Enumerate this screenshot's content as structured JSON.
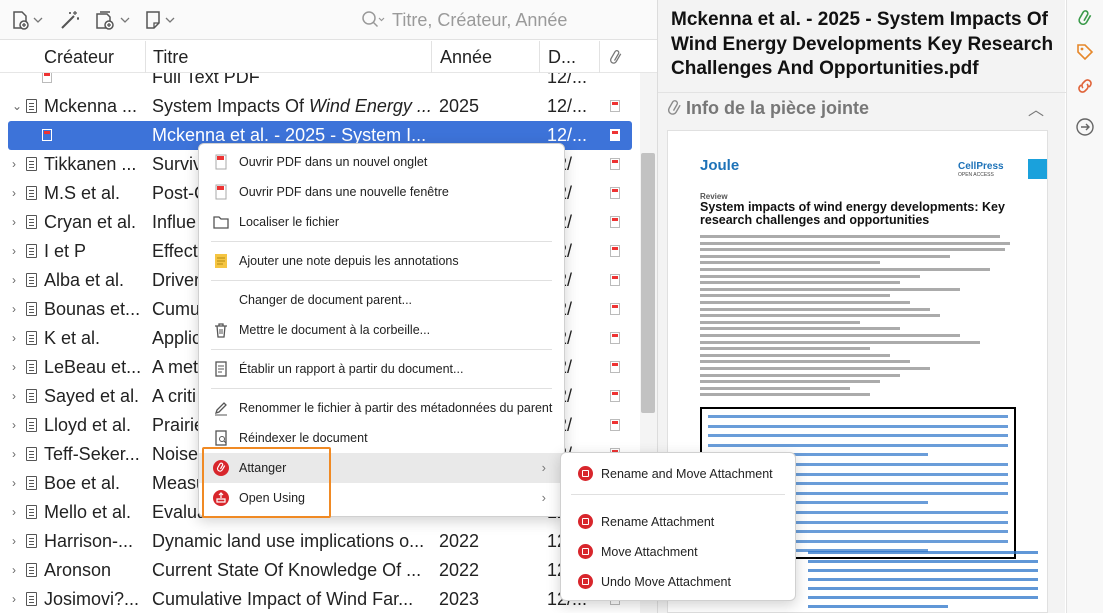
{
  "toolbar": {
    "new_item_icon": "new-item-icon",
    "wand_icon": "magic-wand-icon",
    "attach_icon": "add-attachment-icon",
    "note_icon": "new-note-icon",
    "search_placeholder": "Titre, Créateur, Année"
  },
  "columns": {
    "creator": "Créateur",
    "title": "Titre",
    "year": "Année",
    "date": "D..."
  },
  "rows": [
    {
      "creator": "",
      "title": "Full Text PDF",
      "year": "",
      "date": "12/...",
      "kind": "attachment-child"
    },
    {
      "creator": "Mckenna ...",
      "title_prefix": "System Impacts Of ",
      "title_italic": "Wind Energy ...",
      "year": "2025",
      "date": "12/...",
      "kind": "item-open"
    },
    {
      "creator": "",
      "title": "Mckenna et al. - 2025 - System I...",
      "year": "",
      "date": "12/...",
      "kind": "attachment-selected"
    },
    {
      "creator": "Tikkanen ...",
      "title": "Surviv",
      "year": "",
      "date": "12/",
      "kind": "item"
    },
    {
      "creator": "M.S et al.",
      "title": "Post-C",
      "year": "",
      "date": "12/",
      "kind": "item"
    },
    {
      "creator": "Cryan et al.",
      "title": "Influe",
      "year": "",
      "date": "12/",
      "kind": "item"
    },
    {
      "creator": "I et P",
      "title": "Effect",
      "year": "",
      "date": "12/",
      "kind": "item"
    },
    {
      "creator": "Alba et al.",
      "title": "Driver",
      "year": "",
      "date": "12/",
      "kind": "item"
    },
    {
      "creator": "Bounas et...",
      "title": "Cumu",
      "year": "",
      "date": "12/",
      "kind": "item"
    },
    {
      "creator": "K et al.",
      "title": "Applic",
      "year": "",
      "date": "12/",
      "kind": "item"
    },
    {
      "creator": "LeBeau et...",
      "title": "A met",
      "year": "",
      "date": "12/",
      "kind": "item"
    },
    {
      "creator": "Sayed et al.",
      "title": "A criti",
      "year": "",
      "date": "12/",
      "kind": "item"
    },
    {
      "creator": "Lloyd et al.",
      "title": "Prairie",
      "year": "",
      "date": "12/",
      "kind": "item"
    },
    {
      "creator": "Teff-Seker...",
      "title": "Noise",
      "year": "",
      "date": "12/",
      "kind": "item"
    },
    {
      "creator": "Boe et al.",
      "title": "Measu",
      "year": "",
      "date": "12/",
      "kind": "item"
    },
    {
      "creator": "Mello et al.",
      "title": "Evalua",
      "year": "",
      "date": "12/",
      "kind": "item"
    },
    {
      "creator": "Harrison-...",
      "title": "Dynamic land use implications o...",
      "year": "2022",
      "date": "12/...",
      "kind": "item"
    },
    {
      "creator": "Aronson",
      "title": "Current State Of Knowledge Of ...",
      "year": "2022",
      "date": "12/...",
      "kind": "item"
    },
    {
      "creator": "Josimovi?...",
      "title": "Cumulative Impact of Wind Far...",
      "year": "2023",
      "date": "12/...",
      "kind": "item"
    }
  ],
  "right_pane": {
    "title": "Mckenna et al. - 2025 - System Impacts Of Wind Energy Developments Key Research Challenges And Opportunities.pdf",
    "section_label": "Info de la pièce jointe",
    "preview": {
      "journal": "Joule",
      "publisher": "CellPress",
      "publisher_sub": "OPEN ACCESS",
      "article_type": "Review",
      "article_title": "System impacts of wind energy developments: Key research challenges and opportunities"
    }
  },
  "context_menu": {
    "items": [
      {
        "label": "Ouvrir PDF dans un nouvel onglet",
        "icon": "pdf-icon"
      },
      {
        "label": "Ouvrir PDF dans une nouvelle fenêtre",
        "icon": "pdf-icon"
      },
      {
        "label": "Localiser le fichier",
        "icon": "folder-icon"
      },
      {
        "label": "Ajouter une note depuis les annotations",
        "icon": "note-icon"
      },
      {
        "label": "Changer de document parent...",
        "icon": ""
      },
      {
        "label": "Mettre le document à la corbeille...",
        "icon": "trash-icon"
      },
      {
        "label": "Établir un rapport à partir du document...",
        "icon": "report-icon"
      },
      {
        "label": "Renommer le fichier à partir des métadonnées du parent",
        "icon": "rename-icon"
      },
      {
        "label": "Réindexer le document",
        "icon": "reindex-icon"
      },
      {
        "label": "Attanger",
        "icon": "attanger-icon"
      },
      {
        "label": "Open Using",
        "icon": "open-using-icon"
      }
    ]
  },
  "submenu": {
    "items": [
      {
        "label": "Rename and Move Attachment"
      },
      {
        "label": "Rename Attachment"
      },
      {
        "label": "Move Attachment"
      },
      {
        "label": "Undo Move Attachment"
      }
    ]
  },
  "colors": {
    "selection": "#3d73d9",
    "highlight_box": "#f08a24",
    "attanger_red": "#d8262c",
    "journal_blue": "#1d72b8"
  }
}
